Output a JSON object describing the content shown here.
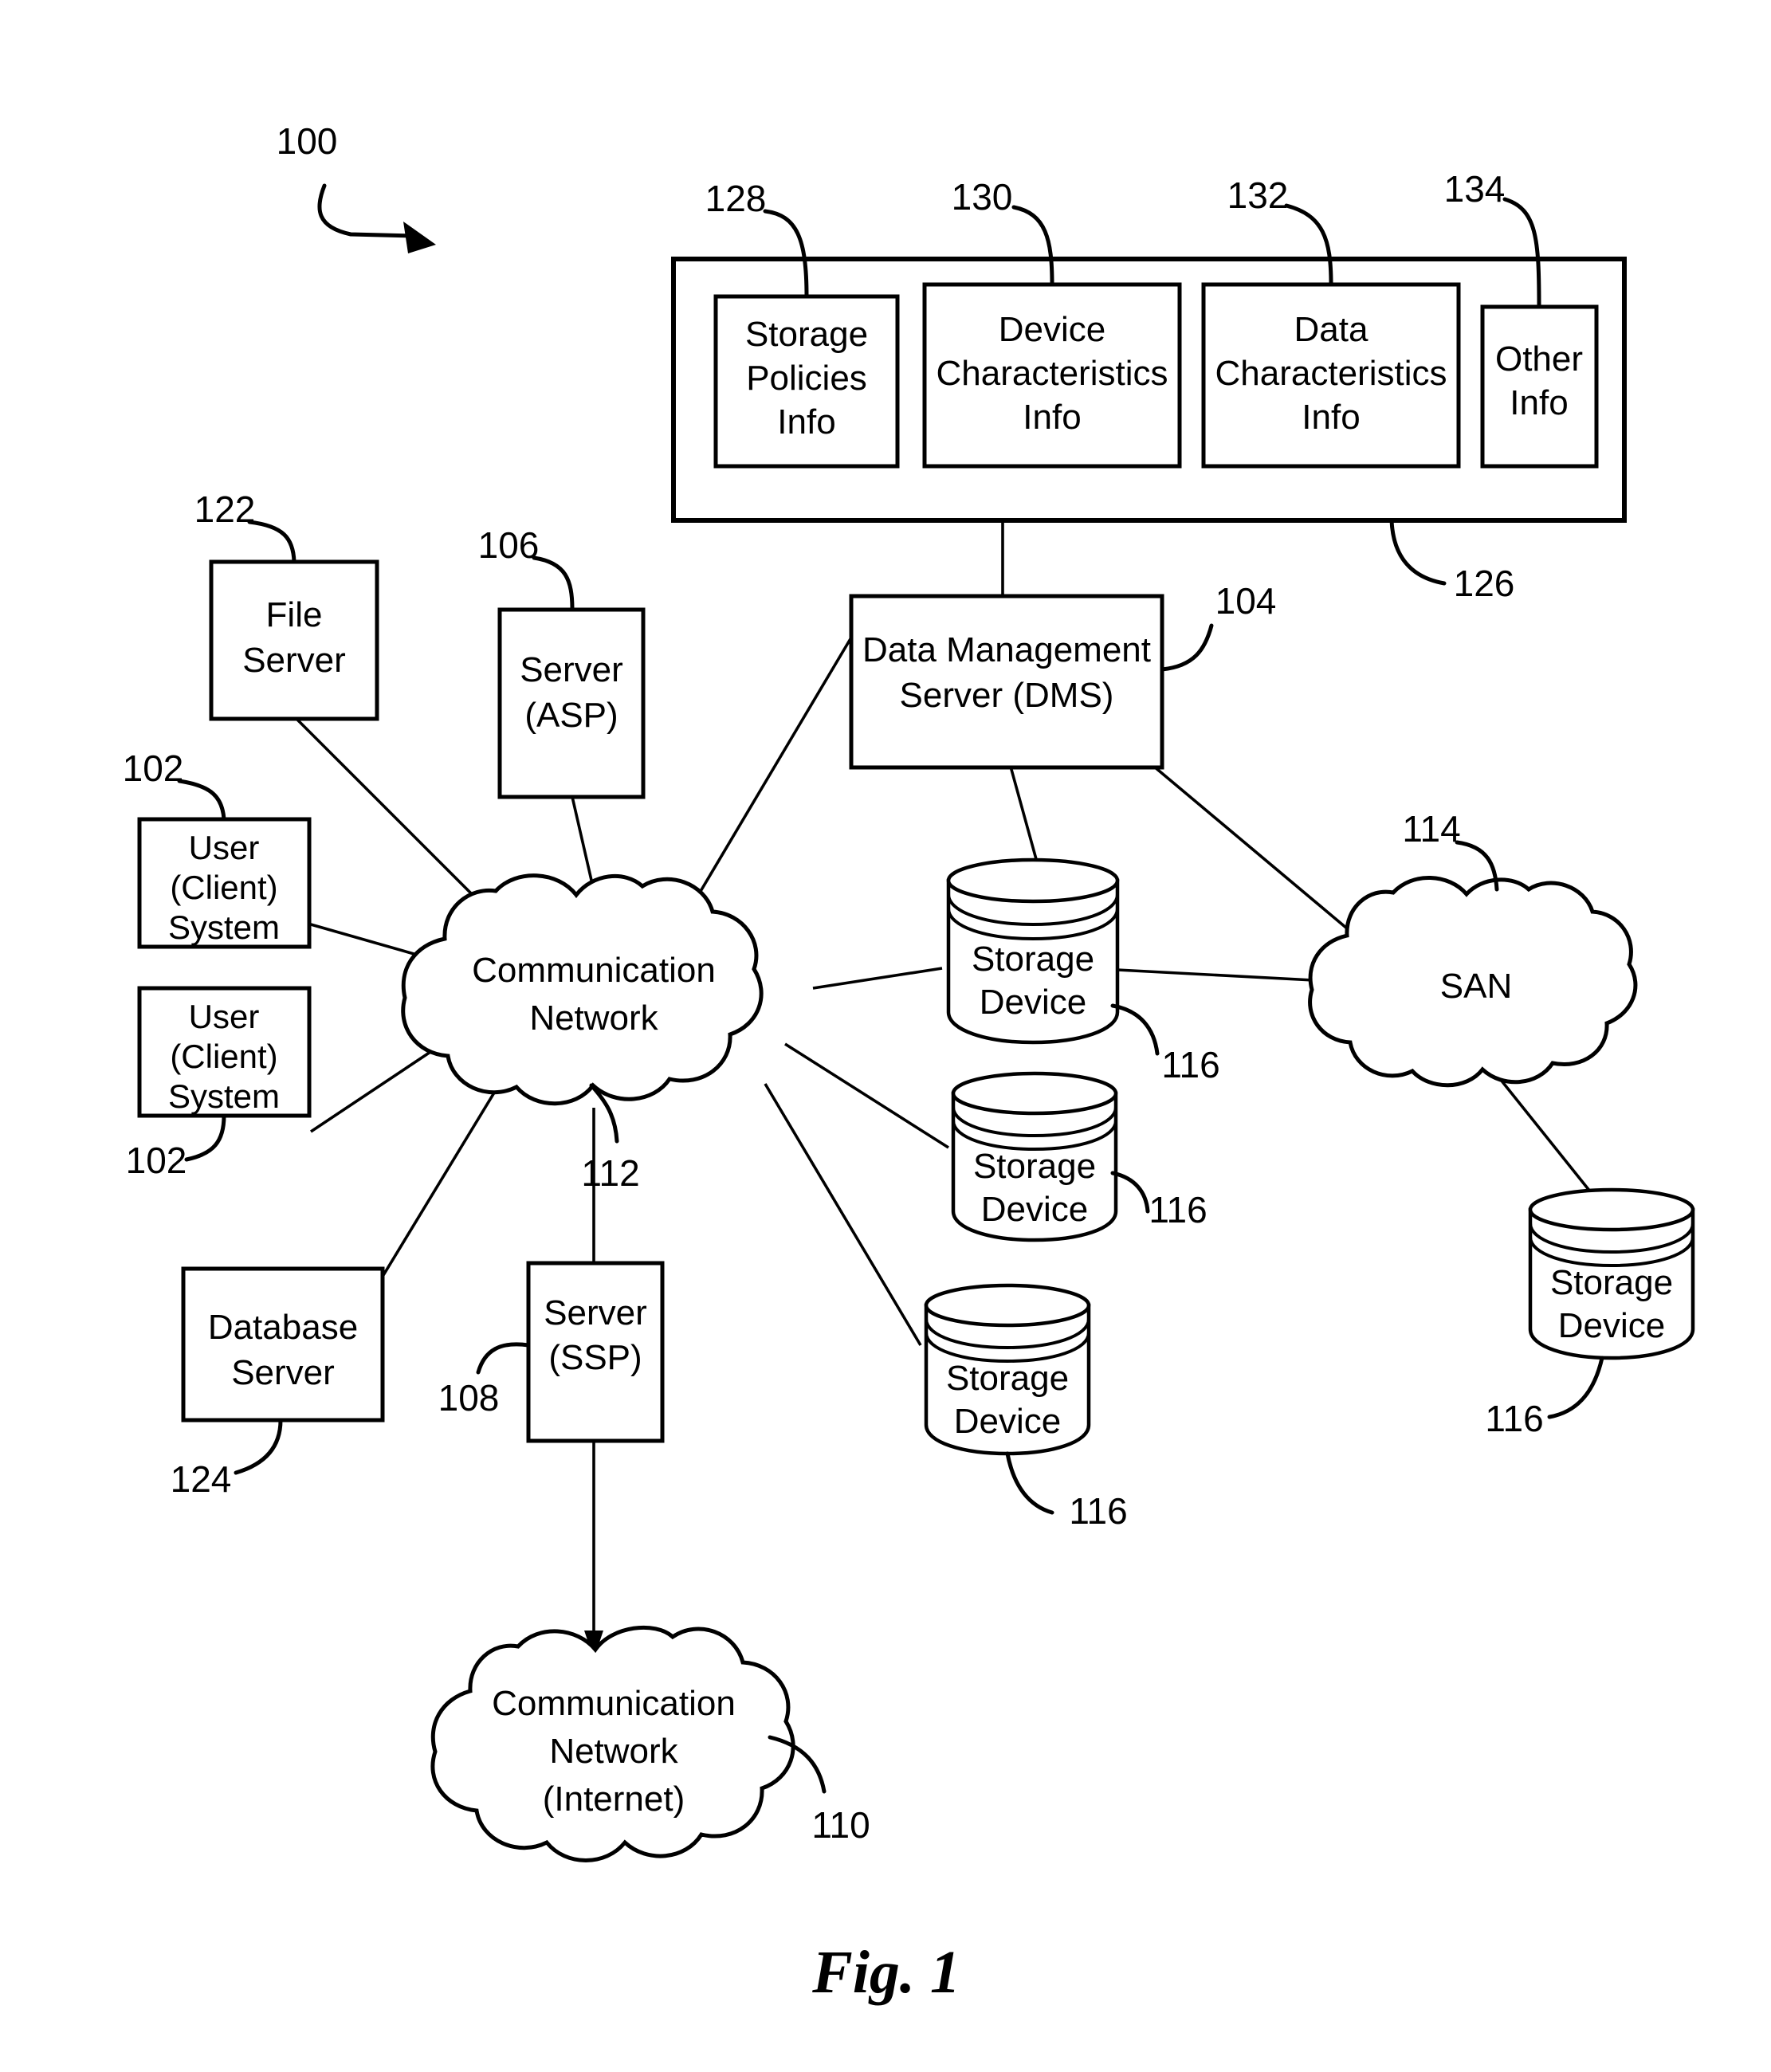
{
  "figure": {
    "caption": "Fig. 1",
    "system_ref": "100"
  },
  "database_container": {
    "ref": "126",
    "boxes": [
      {
        "ref": "128",
        "lines": [
          "Storage",
          "Policies",
          "Info"
        ]
      },
      {
        "ref": "130",
        "lines": [
          "Device",
          "Characteristics",
          "Info"
        ]
      },
      {
        "ref": "132",
        "lines": [
          "Data",
          "Characteristics",
          "Info"
        ]
      },
      {
        "ref": "134",
        "lines": [
          "Other",
          "Info"
        ]
      }
    ]
  },
  "nodes": {
    "file_server": {
      "ref": "122",
      "lines": [
        "File",
        "Server"
      ]
    },
    "server_asp": {
      "ref": "106",
      "lines": [
        "Server",
        "(ASP)"
      ]
    },
    "dms": {
      "ref": "104",
      "lines": [
        "Data Management",
        "Server (DMS)"
      ]
    },
    "user_client_1": {
      "ref": "102",
      "lines": [
        "User",
        "(Client)",
        "System"
      ]
    },
    "user_client_2": {
      "ref": "102",
      "lines": [
        "User",
        "(Client)",
        "System"
      ]
    },
    "database_server": {
      "ref": "124",
      "lines": [
        "Database",
        "Server"
      ]
    },
    "server_ssp": {
      "ref": "108",
      "lines": [
        "Server",
        "(SSP)"
      ]
    },
    "comm_network": {
      "ref": "112",
      "lines": [
        "Communication",
        "Network"
      ]
    },
    "comm_network_internet": {
      "ref": "110",
      "lines": [
        "Communication",
        "Network",
        "(Internet)"
      ]
    },
    "san": {
      "ref": "114",
      "lines": [
        "SAN"
      ]
    },
    "storage_device_1": {
      "ref": "116",
      "lines": [
        "Storage",
        "Device"
      ]
    },
    "storage_device_2": {
      "ref": "116",
      "lines": [
        "Storage",
        "Device"
      ]
    },
    "storage_device_3": {
      "ref": "116",
      "lines": [
        "Storage",
        "Device"
      ]
    },
    "storage_device_4": {
      "ref": "116",
      "lines": [
        "Storage",
        "Device"
      ]
    }
  },
  "colors": {
    "ink": "#000000",
    "paper": "#ffffff"
  }
}
